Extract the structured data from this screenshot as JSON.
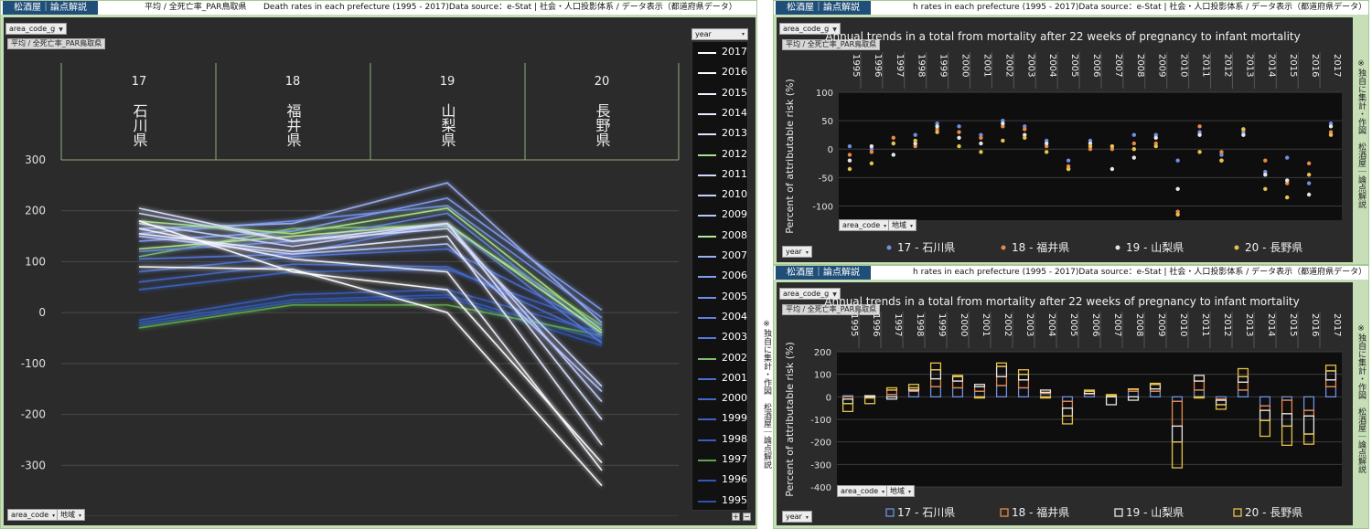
{
  "brand": "松酒屋｜論点解説",
  "left": {
    "header_sheet": "平均 / 全死亡率_PAR鳥取県",
    "header_title": "Death rates in each prefecture (1995 - 2017)Data source：e-Stat | 社会・人口投影体系 / データ表示（都道府県データ）",
    "filter_label": "area_code_g",
    "measure_tag": "平均 / 全死亡率_PAR鳥取県",
    "bottom_area_code": "area_code",
    "bottom_region": "地域",
    "legend_title": "year",
    "btn_plus": "+",
    "btn_minus": "−",
    "credit": "※独自に集計・作図　松酒屋｜論点解説"
  },
  "right_top": {
    "header_title": "h rates in each prefecture (1995 - 2017)Data source：e-Stat | 社会・人口投影体系 / データ表示（都道府県データ）",
    "filter_label": "area_code_g",
    "measure_tag": "平均 / 全死亡率_PAR鳥取県",
    "area_code": "area_code",
    "region": "地域",
    "year_label": "year",
    "credit": "※独自に集計・作図　松酒屋｜論点解説"
  },
  "right_bottom": {
    "header_title": "h rates in each prefecture (1995 - 2017)Data source：e-Stat | 社会・人口投影体系 / データ表示（都道府県データ）",
    "filter_label": "area_code_g",
    "measure_tag": "平均 / 全死亡率_PAR鳥取県",
    "area_code": "area_code",
    "region": "地域",
    "year_label": "year",
    "credit": "※独自に集計・作図　松酒屋｜論点解説"
  },
  "colors": {
    "ishikawa": "#6f8fe0",
    "fukui": "#e8894a",
    "yamanashi": "#e6e6e6",
    "nagano": "#e8c24a"
  },
  "chart_data": [
    {
      "type": "line",
      "categories_code": [
        "17",
        "18",
        "19",
        "20"
      ],
      "categories": [
        "石川県",
        "福井県",
        "山梨県",
        "長野県"
      ],
      "ylim": [
        -400,
        300
      ],
      "yticks": [
        300,
        200,
        100,
        0,
        -100,
        -200,
        -300,
        -400
      ],
      "legend_title": "year",
      "series": [
        {
          "name": "2017",
          "color": "#ffffff",
          "values": [
            90,
            85,
            0,
            -340
          ]
        },
        {
          "name": "2016",
          "color": "#ffffff",
          "values": [
            180,
            80,
            45,
            -295
          ]
        },
        {
          "name": "2015",
          "color": "#f2f2ff",
          "values": [
            165,
            105,
            80,
            -310
          ]
        },
        {
          "name": "2014",
          "color": "#e8ecff",
          "values": [
            155,
            120,
            150,
            -260
          ]
        },
        {
          "name": "2013",
          "color": "#dde4ff",
          "values": [
            205,
            140,
            175,
            -210
          ]
        },
        {
          "name": "2012",
          "color": "#a8e08c",
          "values": [
            180,
            155,
            205,
            -35
          ]
        },
        {
          "name": "2011",
          "color": "#cfd8ff",
          "values": [
            195,
            140,
            165,
            -145
          ]
        },
        {
          "name": "2010",
          "color": "#c6d0ff",
          "values": [
            175,
            130,
            175,
            -175
          ]
        },
        {
          "name": "2009",
          "color": "#b4c4ff",
          "values": [
            150,
            115,
            135,
            -155
          ]
        },
        {
          "name": "2008",
          "color": "#b6e895",
          "values": [
            125,
            150,
            175,
            -40
          ]
        },
        {
          "name": "2007",
          "color": "#9ab0f5",
          "values": [
            165,
            175,
            255,
            -20
          ]
        },
        {
          "name": "2006",
          "color": "#7f9ef0",
          "values": [
            140,
            160,
            225,
            5
          ]
        },
        {
          "name": "2005",
          "color": "#6f8fe8",
          "values": [
            155,
            180,
            210,
            -10
          ]
        },
        {
          "name": "2004",
          "color": "#5f80e0",
          "values": [
            120,
            140,
            195,
            -45
          ]
        },
        {
          "name": "2003",
          "color": "#5577d8",
          "values": [
            105,
            115,
            175,
            -60
          ]
        },
        {
          "name": "2002",
          "color": "#7ec06a",
          "values": [
            110,
            165,
            170,
            -25
          ]
        },
        {
          "name": "2001",
          "color": "#4b6fd0",
          "values": [
            80,
            110,
            125,
            -30
          ]
        },
        {
          "name": "2000",
          "color": "#4468c8",
          "values": [
            60,
            95,
            90,
            -50
          ]
        },
        {
          "name": "1999",
          "color": "#3d62c2",
          "values": [
            45,
            80,
            85,
            -25
          ]
        },
        {
          "name": "1998",
          "color": "#395dbc",
          "values": [
            -15,
            35,
            45,
            -40
          ]
        },
        {
          "name": "1997",
          "color": "#5ea84c",
          "values": [
            -30,
            15,
            15,
            -45
          ]
        },
        {
          "name": "1996",
          "color": "#3358b5",
          "values": [
            -20,
            25,
            35,
            -55
          ]
        },
        {
          "name": "1995",
          "color": "#2f52ad",
          "values": [
            -25,
            20,
            30,
            -65
          ]
        }
      ]
    },
    {
      "type": "scatter",
      "title": "Annual trends in a total from mortality after 22 weeks of pregnancy to infant mortality",
      "ylabel": "Percent of attributable risk (%)",
      "ylim": [
        -125,
        100
      ],
      "yticks": [
        100,
        50,
        0,
        -50,
        -100
      ],
      "years": [
        "1995",
        "1996",
        "1997",
        "1998",
        "1999",
        "2000",
        "2001",
        "2002",
        "2003",
        "2004",
        "2005",
        "2006",
        "2007",
        "2008",
        "2009",
        "2010",
        "2011",
        "2012",
        "2013",
        "2014",
        "2015",
        "2016",
        "2017"
      ],
      "series": [
        {
          "name": "17 - 石川県",
          "values": [
            5,
            0,
            10,
            25,
            45,
            40,
            25,
            50,
            40,
            15,
            -20,
            15,
            5,
            25,
            25,
            -20,
            30,
            -10,
            30,
            -40,
            -15,
            -60,
            45
          ]
        },
        {
          "name": "18 - 福井県",
          "values": [
            -10,
            -5,
            20,
            5,
            35,
            30,
            20,
            40,
            35,
            5,
            -30,
            0,
            0,
            10,
            10,
            -110,
            40,
            -5,
            35,
            -20,
            -60,
            -25,
            30
          ]
        },
        {
          "name": "19 - 山梨県",
          "values": [
            -20,
            5,
            -10,
            10,
            40,
            20,
            10,
            45,
            25,
            10,
            -35,
            10,
            -35,
            -15,
            20,
            -70,
            25,
            -20,
            25,
            -45,
            -55,
            -80,
            40
          ]
        },
        {
          "name": "20 - 長野県",
          "values": [
            -35,
            -25,
            10,
            15,
            30,
            5,
            -5,
            15,
            20,
            -5,
            -35,
            5,
            5,
            0,
            5,
            -115,
            -5,
            -20,
            35,
            -70,
            -85,
            -45,
            25
          ]
        }
      ]
    },
    {
      "type": "bar",
      "stacked": true,
      "title": "Annual trends in a total from mortality after 22 weeks of pregnancy to infant mortality",
      "ylabel": "Percent of attributable risk (%)",
      "ylim": [
        -400,
        200
      ],
      "yticks": [
        200,
        100,
        0,
        -100,
        -200,
        -300,
        -400
      ],
      "years": [
        "1995",
        "1996",
        "1997",
        "1998",
        "1999",
        "2000",
        "2001",
        "2002",
        "2003",
        "2004",
        "2005",
        "2006",
        "2007",
        "2008",
        "2009",
        "2010",
        "2011",
        "2012",
        "2013",
        "2014",
        "2015",
        "2016",
        "2017"
      ],
      "series": [
        {
          "name": "17 - 石川県",
          "values": [
            5,
            0,
            10,
            25,
            45,
            40,
            25,
            50,
            40,
            15,
            -20,
            15,
            5,
            25,
            25,
            -20,
            30,
            -10,
            30,
            -40,
            -15,
            -60,
            45
          ]
        },
        {
          "name": "18 - 福井県",
          "values": [
            -10,
            -5,
            20,
            5,
            35,
            30,
            20,
            40,
            35,
            5,
            -30,
            0,
            0,
            10,
            10,
            -110,
            40,
            -5,
            35,
            -20,
            -60,
            -25,
            30
          ]
        },
        {
          "name": "19 - 山梨県",
          "values": [
            -20,
            5,
            -10,
            10,
            40,
            20,
            10,
            45,
            25,
            10,
            -35,
            10,
            -35,
            -15,
            20,
            -70,
            25,
            -20,
            25,
            -45,
            -55,
            -80,
            40
          ]
        },
        {
          "name": "20 - 長野県",
          "values": [
            -35,
            -25,
            10,
            15,
            30,
            5,
            -5,
            15,
            20,
            -5,
            -35,
            5,
            5,
            0,
            5,
            -115,
            -5,
            -20,
            35,
            -70,
            -85,
            -45,
            25
          ]
        }
      ]
    }
  ]
}
